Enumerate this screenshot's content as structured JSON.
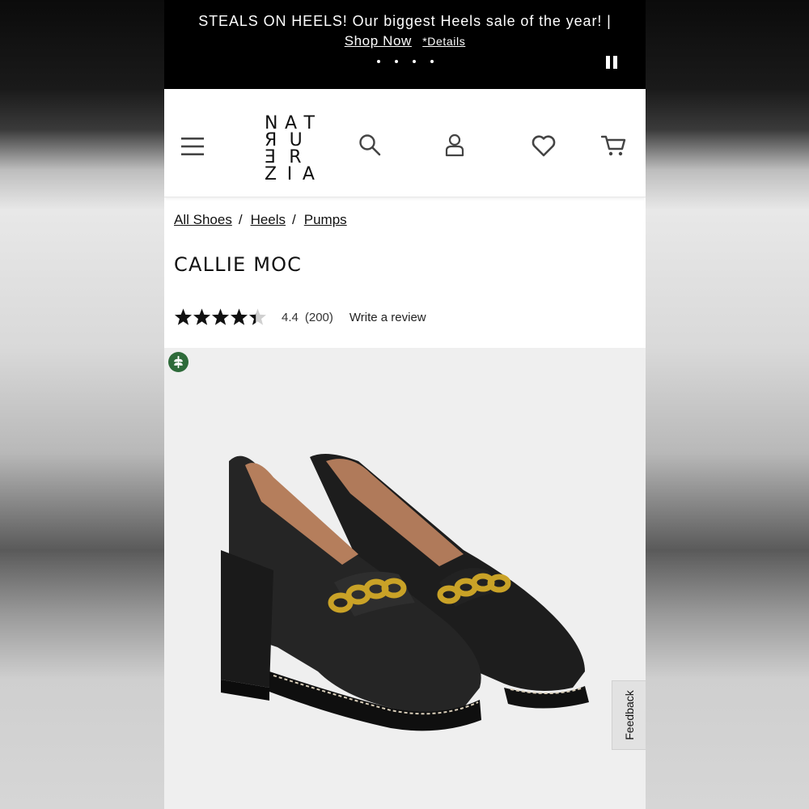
{
  "promo": {
    "headline": "STEALS ON HEELS! Our biggest Heels sale of the year! |",
    "shop_now": "Shop Now",
    "details": "*Details"
  },
  "header": {
    "logo_rows": [
      [
        "N",
        "A",
        "T"
      ],
      [
        "E",
        "R",
        "U"
      ],
      [
        "E",
        "",
        "R"
      ],
      [
        "Z",
        "I",
        "A"
      ]
    ],
    "logo_text": "NATURALIZER"
  },
  "breadcrumb": [
    "All Shoes",
    "Heels",
    "Pumps"
  ],
  "breadcrumb_separator": "/",
  "product": {
    "title": "CALLIE MOC",
    "rating": 4.4,
    "rating_text": "4.4",
    "review_count": "(200)",
    "write_review": "Write a review"
  },
  "feedback_tab": "Feedback",
  "colors": {
    "banner_bg": "#000000",
    "image_bg": "#efefef",
    "eco_badge": "#2e6b3a"
  },
  "icons": [
    "menu-icon",
    "search-icon",
    "account-icon",
    "heart-icon",
    "cart-icon",
    "pause-icon",
    "eco-leaf-icon",
    "star-icon"
  ]
}
